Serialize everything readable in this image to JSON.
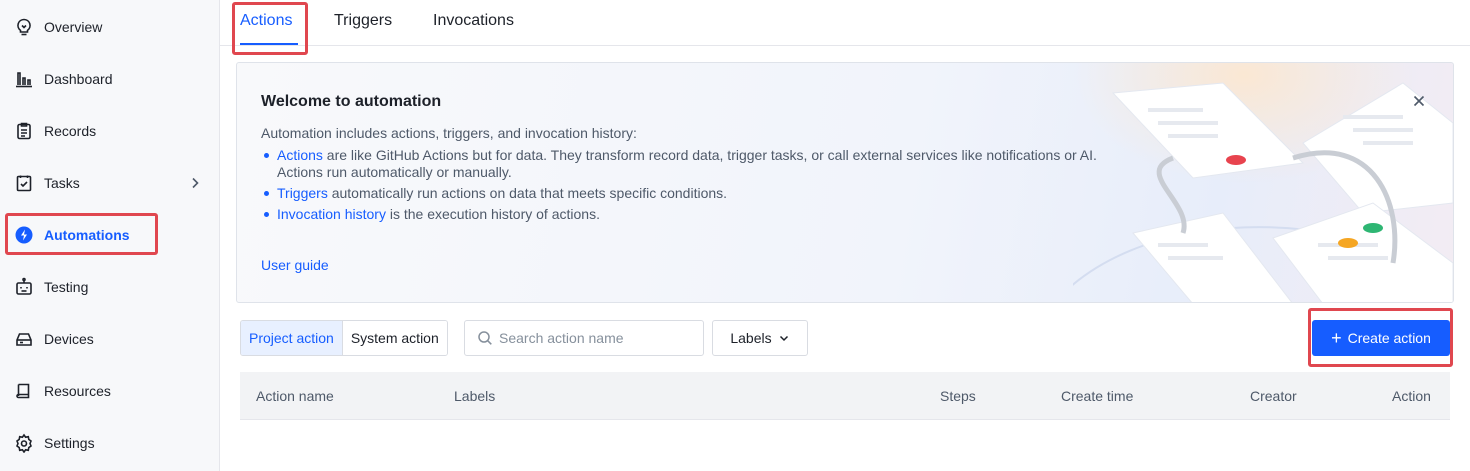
{
  "sidebar": {
    "items": [
      {
        "label": "Overview",
        "icon": "lightbulb-icon"
      },
      {
        "label": "Dashboard",
        "icon": "bar-chart-icon"
      },
      {
        "label": "Records",
        "icon": "clipboard-icon"
      },
      {
        "label": "Tasks",
        "icon": "checklist-icon"
      },
      {
        "label": "Automations",
        "icon": "lightning-icon"
      },
      {
        "label": "Testing",
        "icon": "robot-icon"
      },
      {
        "label": "Devices",
        "icon": "hard-drive-icon"
      },
      {
        "label": "Resources",
        "icon": "book-icon"
      },
      {
        "label": "Settings",
        "icon": "gear-icon"
      }
    ],
    "active": "Automations"
  },
  "tabs": [
    {
      "label": "Actions"
    },
    {
      "label": "Triggers"
    },
    {
      "label": "Invocations"
    }
  ],
  "banner": {
    "title": "Welcome to automation",
    "intro": "Automation includes actions, triggers, and invocation history:",
    "bullets": [
      {
        "link": "Actions",
        "text": " are like GitHub Actions but for data. They transform record data, trigger tasks, or call external services like notifications or AI.",
        "text2": "Actions run automatically or manually."
      },
      {
        "link": "Triggers",
        "text": " automatically run actions on data that meets specific conditions."
      },
      {
        "link": "Invocation history",
        "text": " is the execution history of actions."
      }
    ],
    "user_guide": "User guide"
  },
  "toolbar": {
    "segment": [
      "Project action",
      "System action"
    ],
    "search_placeholder": "Search action name",
    "labels_button": "Labels",
    "create_button": "Create action"
  },
  "table": {
    "columns": [
      "Action name",
      "Labels",
      "Steps",
      "Create time",
      "Creator",
      "Action"
    ]
  },
  "colors": {
    "accent": "#165dff",
    "highlight": "#e0474f"
  }
}
